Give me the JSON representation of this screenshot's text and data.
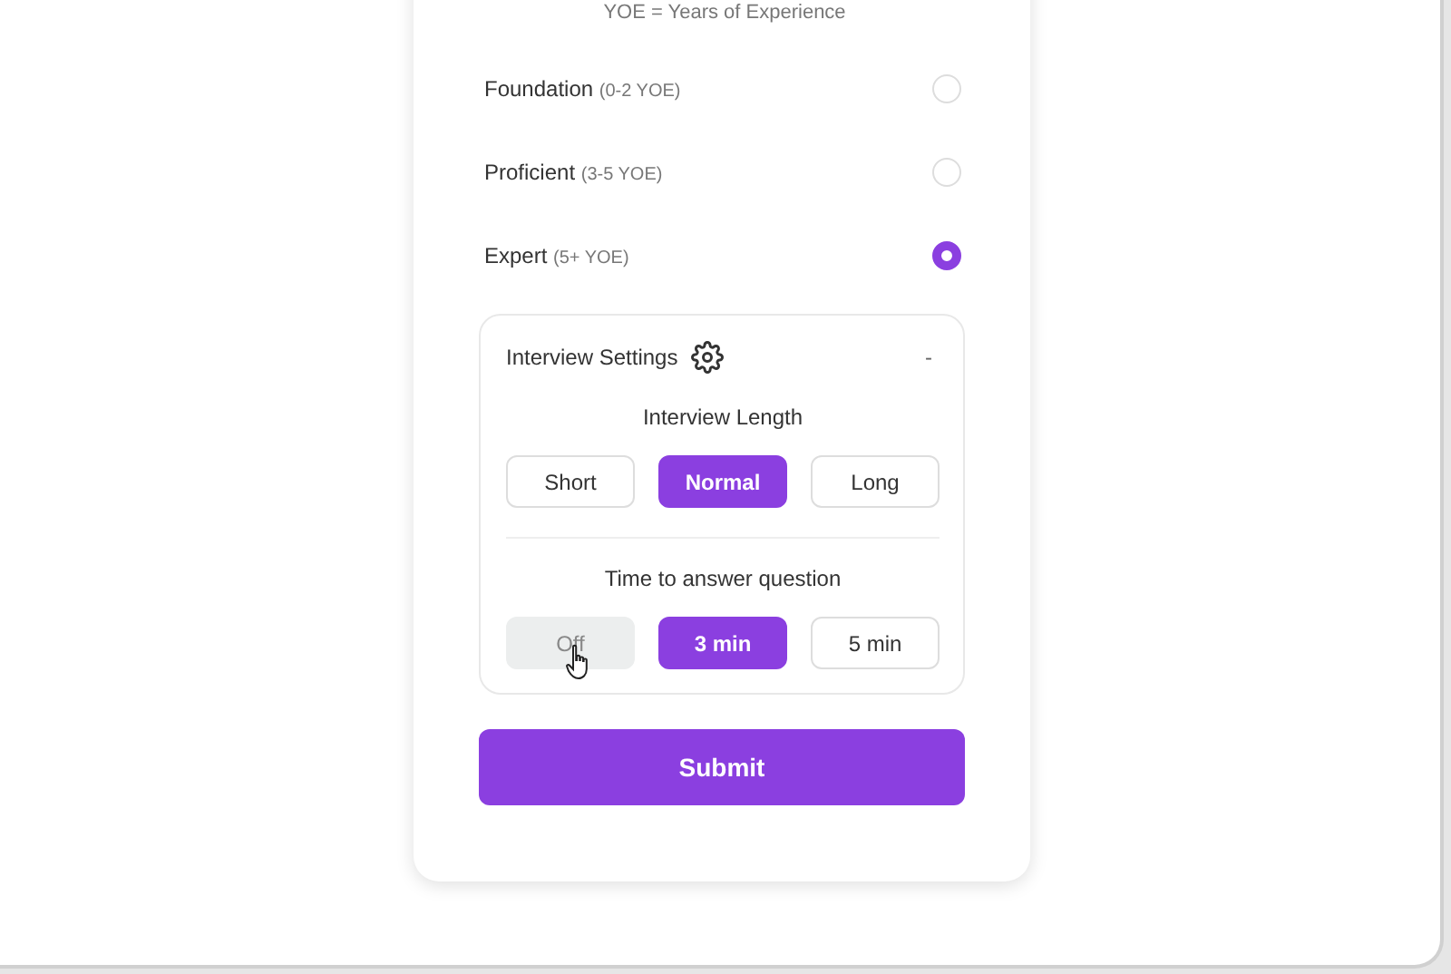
{
  "note": "YOE = Years of Experience",
  "levels": [
    {
      "name": "Foundation",
      "range": "(0-2 YOE)",
      "selected": false
    },
    {
      "name": "Proficient",
      "range": "(3-5 YOE)",
      "selected": false
    },
    {
      "name": "Expert",
      "range": "(5+ YOE)",
      "selected": true
    }
  ],
  "settings": {
    "title": "Interview Settings",
    "expanded": true,
    "collapse_symbol": "-",
    "groups": [
      {
        "label": "Interview Length",
        "options": [
          {
            "label": "Short",
            "selected": false,
            "hovered": false
          },
          {
            "label": "Normal",
            "selected": true,
            "hovered": false
          },
          {
            "label": "Long",
            "selected": false,
            "hovered": false
          }
        ]
      },
      {
        "label": "Time to answer question",
        "options": [
          {
            "label": "Off",
            "selected": false,
            "hovered": true
          },
          {
            "label": "3 min",
            "selected": true,
            "hovered": false
          },
          {
            "label": "5 min",
            "selected": false,
            "hovered": false
          }
        ]
      }
    ]
  },
  "submit": "Submit"
}
